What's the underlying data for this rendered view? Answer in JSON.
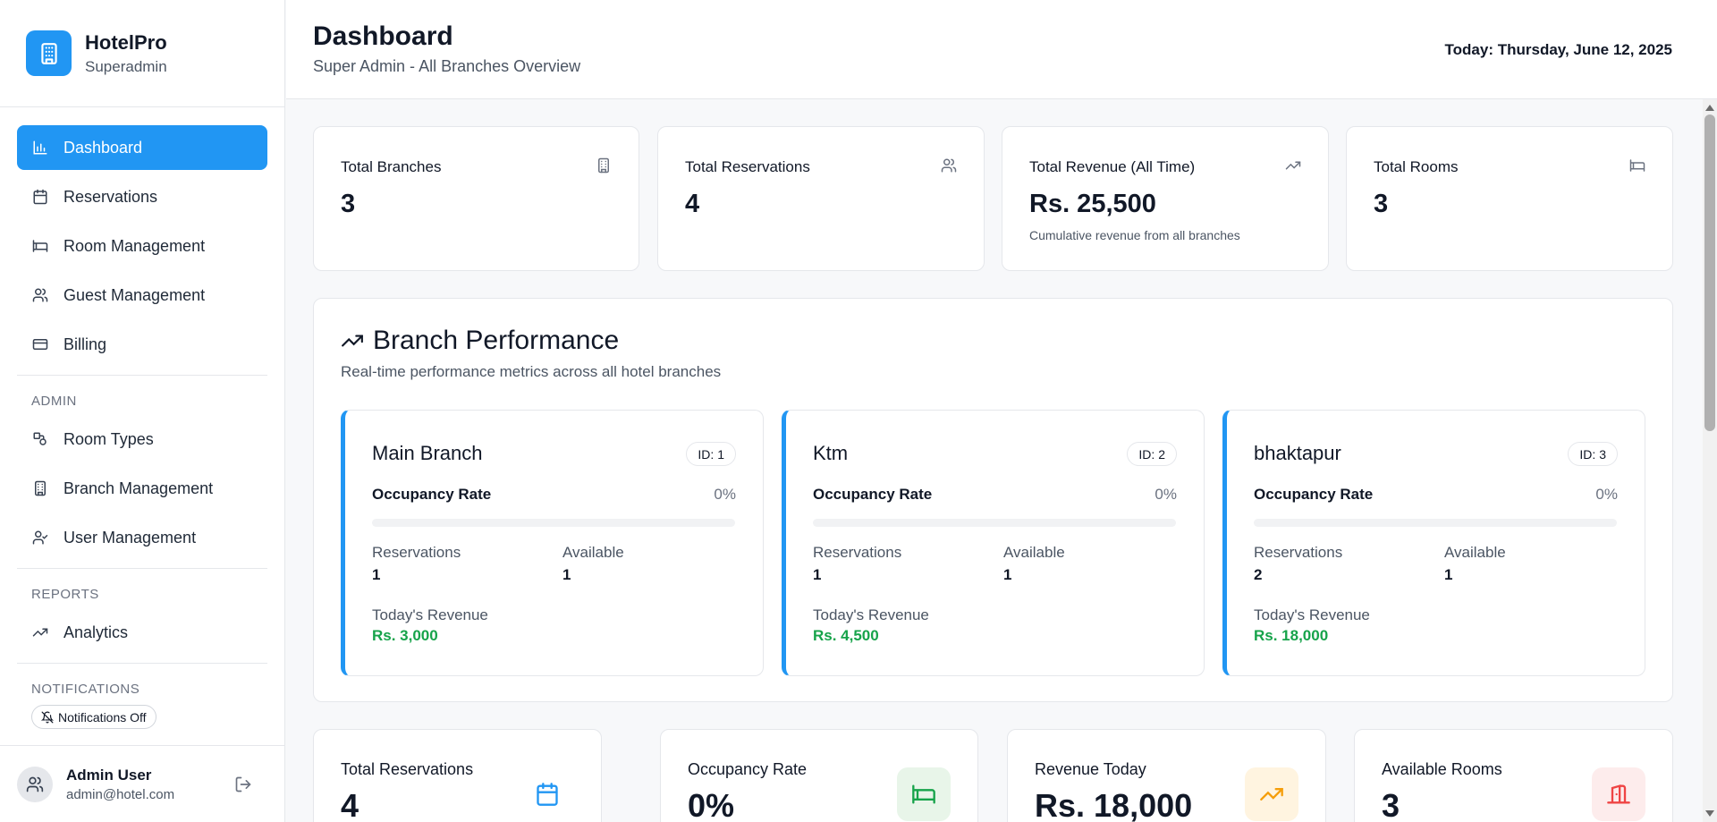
{
  "brand": {
    "name": "HotelPro",
    "role": "Superadmin",
    "icon": "building-icon"
  },
  "nav": {
    "main": [
      {
        "label": "Dashboard",
        "icon": "bar-chart-icon",
        "active": true
      },
      {
        "label": "Reservations",
        "icon": "calendar-icon"
      },
      {
        "label": "Room Management",
        "icon": "bed-icon"
      },
      {
        "label": "Guest Management",
        "icon": "users-icon"
      },
      {
        "label": "Billing",
        "icon": "credit-card-icon"
      }
    ],
    "admin_label": "ADMIN",
    "admin": [
      {
        "label": "Room Types",
        "icon": "shapes-icon"
      },
      {
        "label": "Branch Management",
        "icon": "building-icon"
      },
      {
        "label": "User Management",
        "icon": "user-check-icon"
      }
    ],
    "reports_label": "REPORTS",
    "reports": [
      {
        "label": "Analytics",
        "icon": "trending-up-icon"
      }
    ],
    "notifications_label": "NOTIFICATIONS",
    "notifications_pill": "Notifications Off"
  },
  "user": {
    "name": "Admin User",
    "email": "admin@hotel.com"
  },
  "header": {
    "title": "Dashboard",
    "subtitle": "Super Admin - All Branches Overview",
    "today": "Today: Thursday, June 12, 2025"
  },
  "stats": [
    {
      "title": "Total Branches",
      "value": "3",
      "icon": "building-icon"
    },
    {
      "title": "Total Reservations",
      "value": "4",
      "icon": "users-icon"
    },
    {
      "title": "Total Revenue (All Time)",
      "value": "Rs. 25,500",
      "note": "Cumulative revenue from all branches",
      "icon": "trending-up-icon"
    },
    {
      "title": "Total Rooms",
      "value": "3",
      "icon": "bed-icon"
    }
  ],
  "performance": {
    "title": "Branch Performance",
    "subtitle": "Real-time performance metrics across all hotel branches",
    "labels": {
      "occupancy": "Occupancy Rate",
      "reservations": "Reservations",
      "available": "Available",
      "revenue": "Today's Revenue"
    },
    "branches": [
      {
        "name": "Main Branch",
        "id": "ID: 1",
        "occupancy": "0%",
        "occupancy_value": 0,
        "reservations": "1",
        "available": "1",
        "revenue": "Rs. 3,000"
      },
      {
        "name": "Ktm",
        "id": "ID: 2",
        "occupancy": "0%",
        "occupancy_value": 0,
        "reservations": "1",
        "available": "1",
        "revenue": "Rs. 4,500"
      },
      {
        "name": "bhaktapur",
        "id": "ID: 3",
        "occupancy": "0%",
        "occupancy_value": 0,
        "reservations": "2",
        "available": "1",
        "revenue": "Rs. 18,000"
      }
    ]
  },
  "summary": [
    {
      "title": "Total Reservations",
      "value": "4",
      "icon": "calendar-icon",
      "color": "#2196f3"
    },
    {
      "title": "Occupancy Rate",
      "value": "0%",
      "icon": "bed-icon",
      "color": "#16a34a",
      "bg": "#e8f5e9"
    },
    {
      "title": "Revenue Today",
      "value": "Rs. 18,000",
      "icon": "trending-up-icon",
      "color": "#f59e0b",
      "bg": "#fff4e0"
    },
    {
      "title": "Available Rooms",
      "value": "3",
      "icon": "door-icon",
      "color": "#ef4444",
      "bg": "#fdecec"
    }
  ]
}
